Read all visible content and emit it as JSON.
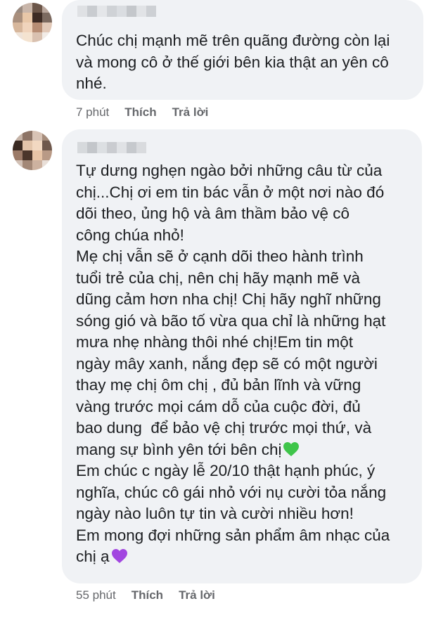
{
  "comments": [
    {
      "text": "Chúc chị mạnh mẽ trên quãng đường còn lại\nvà mong cô ở thế giới bên kia thật an yên cô\nnhé.",
      "time": "7 phút",
      "like_label": "Thích",
      "reply_label": "Trả lời"
    },
    {
      "text_a": "Tự dưng nghẹn ngào bởi những câu từ của\nchị...Chị ơi em tin bác vẫn ở một nơi nào đó\ndõi theo, ủng hộ và âm thầm bảo vệ cô\ncông chúa nhỏ!\nMẹ chị vẫn sẽ ở cạnh dõi theo hành trình\ntuổi trẻ của chị, nên chị hãy mạnh mẽ và\ndũng cảm hơn nha chị! Chị hãy nghĩ những\nsóng gió và bão tố vừa qua chỉ là những hạt\nmưa nhẹ nhàng thôi nhé chị!Em tin một\nngày mây xanh, nắng đẹp sẽ có một người\nthay mẹ chị ôm chị , đủ bản lĩnh và vững\nvàng trước mọi cám dỗ của cuộc đời, đủ\nbao dung  để bảo vệ chị trước mọi thứ, và\nmang sự bình yên tới bên chị",
      "heart_a": "green-heart-emoji",
      "text_b": "\nEm chúc c ngày lễ 20/10 thật hạnh phúc, ý\nnghĩa, chúc cô gái nhỏ với nụ cười tỏa nắng\nngày nào luôn tự tin và cười nhiều hơn!\nEm mong đợi những sản phẩm âm nhạc của\nchị ạ",
      "heart_b": "purple-heart-emoji",
      "time": "55 phút",
      "like_label": "Thích",
      "reply_label": "Trả lời"
    }
  ],
  "colors": {
    "bubble": "#f0f2f5",
    "meta": "#65676b",
    "green_heart": "#3fc54a",
    "purple_heart": "#a246e0"
  }
}
